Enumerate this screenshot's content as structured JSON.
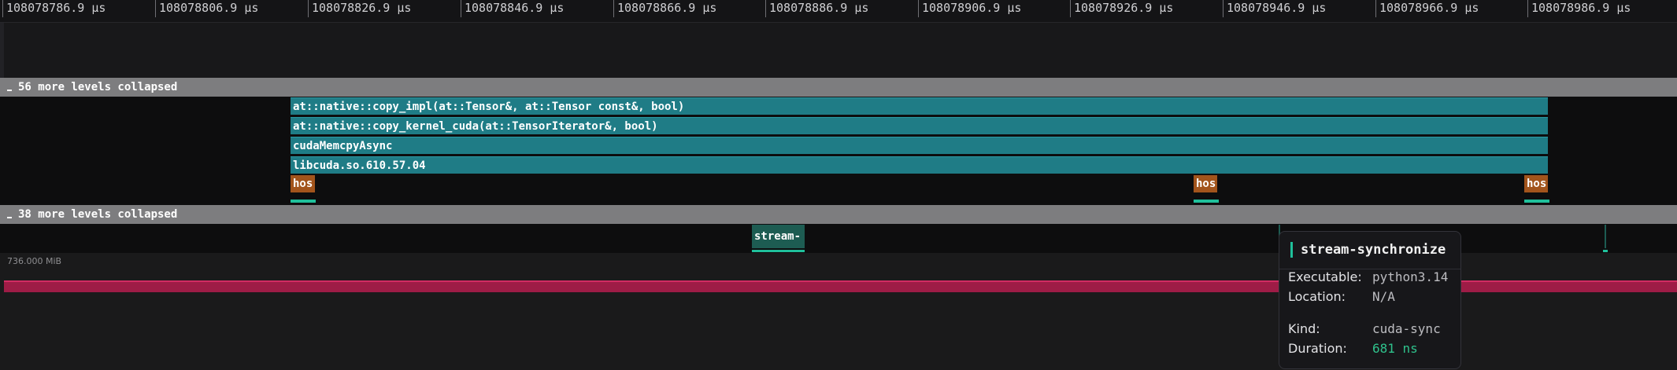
{
  "ruler": {
    "ticks": [
      "108078786.9 µs",
      "108078806.9 µs",
      "108078826.9 µs",
      "108078846.9 µs",
      "108078866.9 µs",
      "108078886.9 µs",
      "108078906.9 µs",
      "108078926.9 µs",
      "108078946.9 µs",
      "108078966.9 µs",
      "108078986.9 µs"
    ]
  },
  "collapsed": {
    "top_label": "56 more levels collapsed",
    "bottom_label": "38 more levels collapsed"
  },
  "frames": [
    "at::native::copy_impl(at::Tensor&, at::Tensor const&, bool)",
    "at::native::copy_kernel_cuda(at::TensorIterator&, bool)",
    "cudaMemcpyAsync",
    "libcuda.so.610.57.04"
  ],
  "host_events": [
    "hos",
    "hos",
    "hos"
  ],
  "stream_event": "stream-",
  "memory": {
    "label": "736.000 MiB"
  },
  "tooltip": {
    "title": "stream-synchronize",
    "executable_key": "Executable:",
    "executable_val": "python3.14",
    "location_key": "Location:",
    "location_val": "N/A",
    "kind_key": "Kind:",
    "kind_val": "cuda-sync",
    "duration_key": "Duration:",
    "duration_val": "681 ns"
  },
  "colors": {
    "frame": "#1f7c86",
    "host": "#a2541c",
    "accent": "#1fc09b",
    "memory": "#9e1c46"
  }
}
